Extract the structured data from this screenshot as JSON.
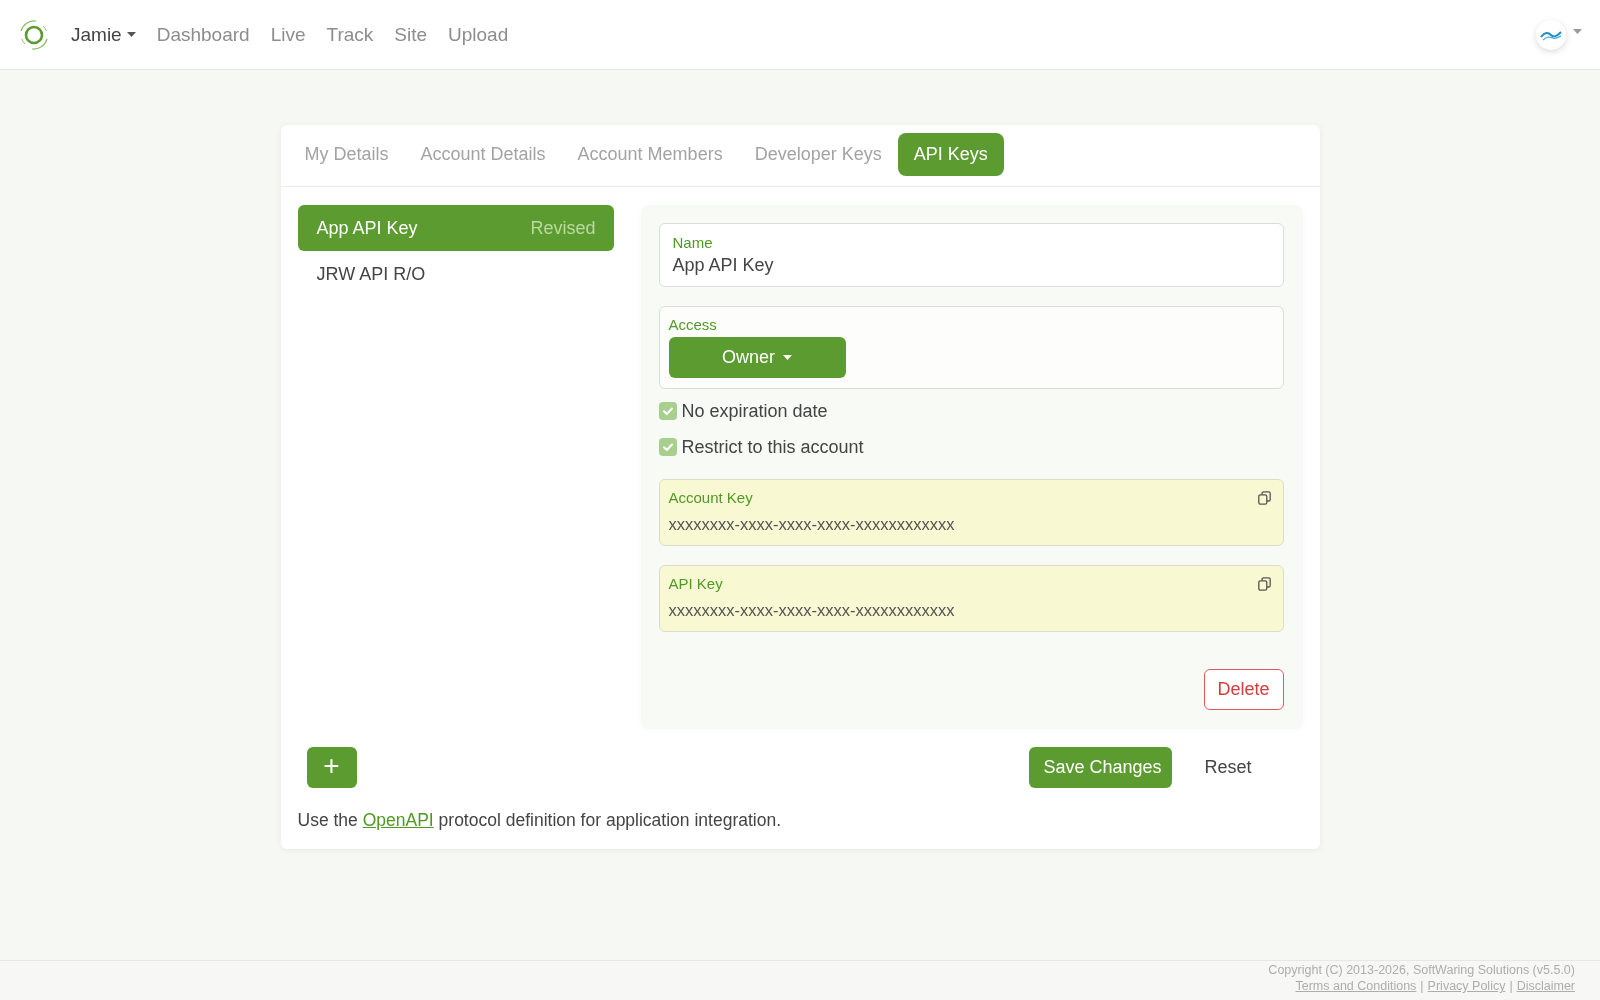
{
  "navbar": {
    "user_menu": "Jamie",
    "links": [
      "Dashboard",
      "Live",
      "Track",
      "Site",
      "Upload"
    ]
  },
  "tabs": [
    {
      "label": "My Details",
      "selected": false
    },
    {
      "label": "Account Details",
      "selected": false
    },
    {
      "label": "Account Members",
      "selected": false
    },
    {
      "label": "Developer Keys",
      "selected": false
    },
    {
      "label": "API Keys",
      "selected": true
    }
  ],
  "key_list": [
    {
      "name": "App API Key",
      "status": "Revised",
      "selected": true
    },
    {
      "name": "JRW API R/O",
      "selected": false
    }
  ],
  "key_form": {
    "name": {
      "label": "Name",
      "value": "App API Key"
    },
    "access": {
      "label": "Access",
      "value": "Owner"
    },
    "options": [
      {
        "label": "No expiration date",
        "checked": true
      },
      {
        "label": "Restrict to this account",
        "checked": true
      }
    ],
    "keys": [
      {
        "label": "Account Key",
        "value": "xxxxxxxx-xxxx-xxxx-xxxx-xxxxxxxxxxxx"
      },
      {
        "label": "API Key",
        "value": "xxxxxxxx-xxxx-xxxx-xxxx-xxxxxxxxxxxx"
      }
    ],
    "delete_button": "Delete"
  },
  "add_button": "+",
  "save_button": "Save Changes",
  "reset_button": "Reset",
  "note": {
    "before": "Use the ",
    "link": "OpenAPI",
    "after": " protocol definition for application integration."
  },
  "footer": {
    "copyright": "Copyright (C) 2013-2026, SoftWaring Solutions (v5.5.0)",
    "links": [
      {
        "kind": "link",
        "text": "Terms and Conditions"
      },
      {
        "kind": "separator",
        "text": "|"
      },
      {
        "kind": "link",
        "text": "Privacy Policy"
      },
      {
        "kind": "separator",
        "text": "|"
      },
      {
        "kind": "link",
        "text": "Disclaimer"
      }
    ]
  }
}
